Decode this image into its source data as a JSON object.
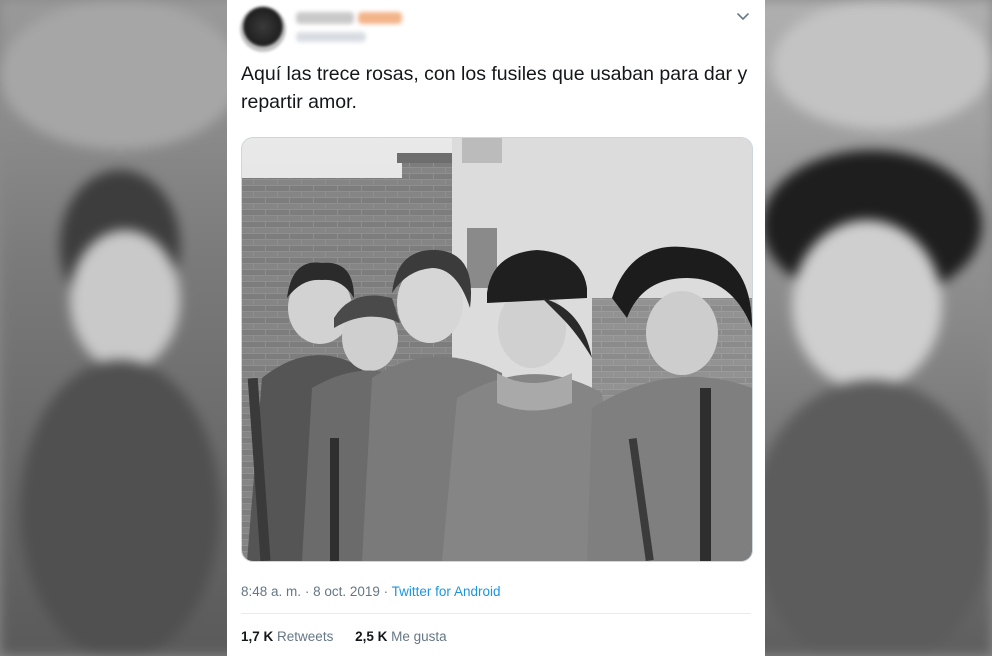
{
  "tweet": {
    "text": "Aquí las trece rosas, con los fusiles que usaban para dar y repartir amor.",
    "time": "8:48 a. m.",
    "separator": "·",
    "date": "8 oct. 2019",
    "separator2": "·",
    "source": "Twitter for Android",
    "retweets_count": "1,7 K",
    "retweets_label": "Retweets",
    "likes_count": "2,5 K",
    "likes_label": "Me gusta"
  },
  "icons": {
    "menu": "chevron-down-icon"
  },
  "colors": {
    "link": "#1b95e0",
    "text": "#14171a",
    "muted": "#657786",
    "border": "#e6ecf0"
  }
}
